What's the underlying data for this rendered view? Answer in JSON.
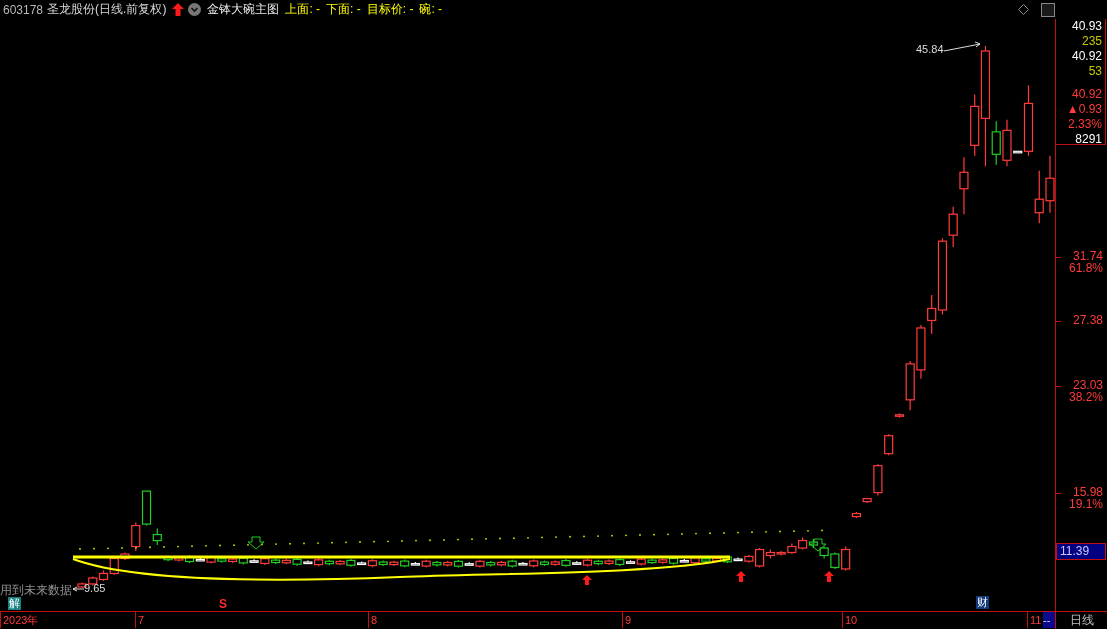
{
  "header": {
    "code": "603178",
    "name": "圣龙股份(日线.前复权)",
    "indicator": "金钵大碗主图",
    "fields": [
      {
        "label": "上面:",
        "value": "-"
      },
      {
        "label": "下面:",
        "value": "-"
      },
      {
        "label": "目标价:",
        "value": "-"
      },
      {
        "label": "碗:",
        "value": "-"
      }
    ]
  },
  "info_panel": [
    {
      "text": "40.93",
      "color": "#ffffff"
    },
    {
      "text": "235",
      "color": "#c8c800"
    },
    {
      "text": "40.92",
      "color": "#ffffff"
    },
    {
      "text": "53",
      "color": "#c8c800"
    },
    {
      "text": "40.92",
      "color": "#ff3b3b"
    },
    {
      "text": "▲0.93",
      "color": "#ff3b3b"
    },
    {
      "text": "2.33%",
      "color": "#ff3b3b"
    },
    {
      "text": "8291",
      "color": "#ffffff"
    }
  ],
  "price_axis": [
    {
      "value": "31.74",
      "ratio": "61.8%"
    },
    {
      "value": "27.38"
    },
    {
      "value": "23.03",
      "ratio": "38.2%"
    },
    {
      "value": "15.98",
      "ratio": "19.1%"
    }
  ],
  "current_price": "11.39",
  "chart": {
    "high_label": "45.84",
    "low_label": "9.65",
    "warning": "用到未来数据",
    "badges": [
      "解",
      "财"
    ],
    "signal": "S"
  },
  "time_axis": [
    "2023年",
    "7",
    "8",
    "9",
    "10",
    "11"
  ],
  "scroll_cell": "--",
  "period_tab": "日线"
}
